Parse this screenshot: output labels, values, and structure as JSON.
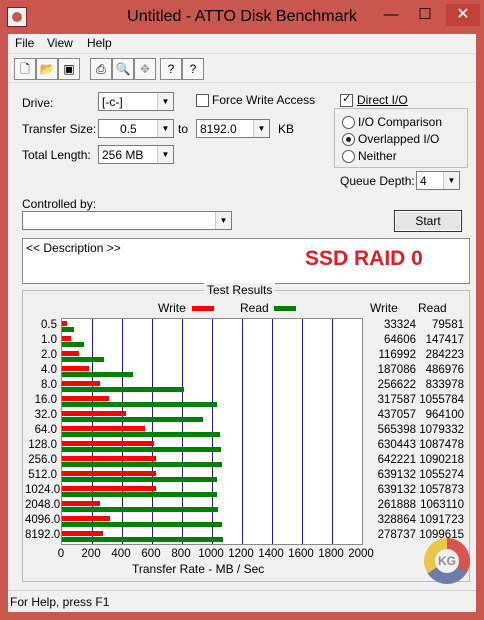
{
  "window": {
    "title": "Untitled - ATTO Disk Benchmark",
    "minimize": "—",
    "maximize": "☐",
    "close": "✕"
  },
  "menu": [
    "File",
    "View",
    "Help"
  ],
  "toolbar_icons": [
    "new-file-icon",
    "open-folder-icon",
    "save-icon",
    "print-icon",
    "print-preview-icon",
    "move-icon",
    "help-icon",
    "context-help-icon"
  ],
  "form": {
    "drive_label": "Drive:",
    "drive_value": "[-c-]",
    "force_write_label": "Force Write Access",
    "force_write_checked": false,
    "direct_io_label": "Direct I/O",
    "direct_io_checked": true,
    "transfer_size_label": "Transfer Size:",
    "transfer_from": "0.5",
    "to_label": "to",
    "transfer_to": "8192.0",
    "kb_label": "KB",
    "total_length_label": "Total Length:",
    "total_length_value": "256 MB",
    "io_options": [
      "I/O Comparison",
      "Overlapped I/O",
      "Neither"
    ],
    "io_selected": "Overlapped I/O",
    "queue_depth_label": "Queue Depth:",
    "queue_depth_value": "4",
    "controlled_by_label": "Controlled by:",
    "controlled_by_value": "",
    "start_label": "Start",
    "description": "<< Description >>",
    "annotation": "SSD RAID 0"
  },
  "results": {
    "title": "Test Results",
    "write_label": "Write",
    "read_label": "Read",
    "col_write": "Write",
    "col_read": "Read",
    "write_color": "#ff0000",
    "read_color": "#008000"
  },
  "chart_data": {
    "type": "bar",
    "orientation": "horizontal",
    "xlabel": "Transfer Rate - MB / Sec",
    "xlim": [
      0,
      2000
    ],
    "xticks": [
      0,
      200,
      400,
      600,
      800,
      1000,
      1200,
      1400,
      1600,
      1800,
      2000
    ],
    "categories": [
      "0.5",
      "1.0",
      "2.0",
      "4.0",
      "8.0",
      "16.0",
      "32.0",
      "64.0",
      "128.0",
      "256.0",
      "512.0",
      "1024.0",
      "2048.0",
      "4096.0",
      "8192.0"
    ],
    "series": [
      {
        "name": "Write",
        "values_kb": [
          33324,
          64606,
          116992,
          187086,
          256622,
          317587,
          437057,
          565398,
          630443,
          642221,
          639132,
          639132,
          261888,
          328864,
          278737
        ]
      },
      {
        "name": "Read",
        "values_kb": [
          79581,
          147417,
          284223,
          486976,
          833978,
          1055784,
          964100,
          1079332,
          1087478,
          1090218,
          1055274,
          1057873,
          1063110,
          1091723,
          1099615
        ]
      }
    ]
  },
  "watermark": "KG",
  "statusbar": "For Help, press F1"
}
